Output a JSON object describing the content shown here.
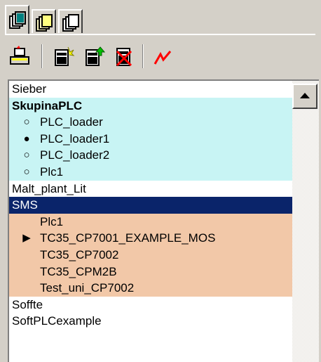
{
  "tabs": [
    {
      "icon": "tree-pages-icon",
      "active": true
    },
    {
      "icon": "folder-pages-icon",
      "active": false
    },
    {
      "icon": "copy-pages-icon",
      "active": false
    }
  ],
  "toolbar": {
    "buttons": [
      {
        "icon": "connect-tray-icon"
      },
      {
        "icon": "new-document-icon"
      },
      {
        "icon": "add-document-icon"
      },
      {
        "icon": "delete-document-icon"
      },
      {
        "icon": "trend-chart-icon"
      }
    ]
  },
  "list": {
    "rows": [
      {
        "text": "Sieber",
        "kind": "top",
        "bg": "white"
      },
      {
        "text": "SkupinaPLC",
        "kind": "group",
        "bg": "cyan"
      },
      {
        "text": "PLC_loader",
        "kind": "bullet",
        "marker": "○",
        "bg": "cyan"
      },
      {
        "text": "PLC_loader1",
        "kind": "bullet",
        "marker": "●",
        "bg": "cyan"
      },
      {
        "text": "PLC_loader2",
        "kind": "bullet",
        "marker": "○",
        "bg": "cyan"
      },
      {
        "text": "Plc1",
        "kind": "bullet",
        "marker": "○",
        "bg": "cyan"
      },
      {
        "text": "Malt_plant_Lit",
        "kind": "top",
        "bg": "white"
      },
      {
        "text": "SMS",
        "kind": "top",
        "bg": "sel"
      },
      {
        "text": "Plc1",
        "kind": "child",
        "marker": "",
        "bg": "tan"
      },
      {
        "text": "TC35_CP7001_EXAMPLE_MOS",
        "kind": "child",
        "marker": "▶",
        "bg": "tan"
      },
      {
        "text": "TC35_CP7002",
        "kind": "child",
        "marker": "",
        "bg": "tan"
      },
      {
        "text": "TC35_CPM2B",
        "kind": "child",
        "marker": "",
        "bg": "tan"
      },
      {
        "text": "Test_uni_CP7002",
        "kind": "child",
        "marker": "",
        "bg": "tan"
      },
      {
        "text": "Soffte",
        "kind": "top",
        "bg": "white"
      },
      {
        "text": "SoftPLCexample",
        "kind": "top",
        "bg": "white"
      },
      {
        "text": "",
        "kind": "top",
        "bg": "white"
      },
      {
        "text": "",
        "kind": "top",
        "bg": "white"
      }
    ]
  },
  "colors": {
    "window_bg": "#d4d0c8",
    "group_bg": "#c8f4f4",
    "child_bg": "#f2c8a8",
    "selection_bg": "#0a246a",
    "selection_fg": "#ffffff"
  },
  "scrollbar": {
    "up_icon": "scroll-up-arrow-icon"
  }
}
